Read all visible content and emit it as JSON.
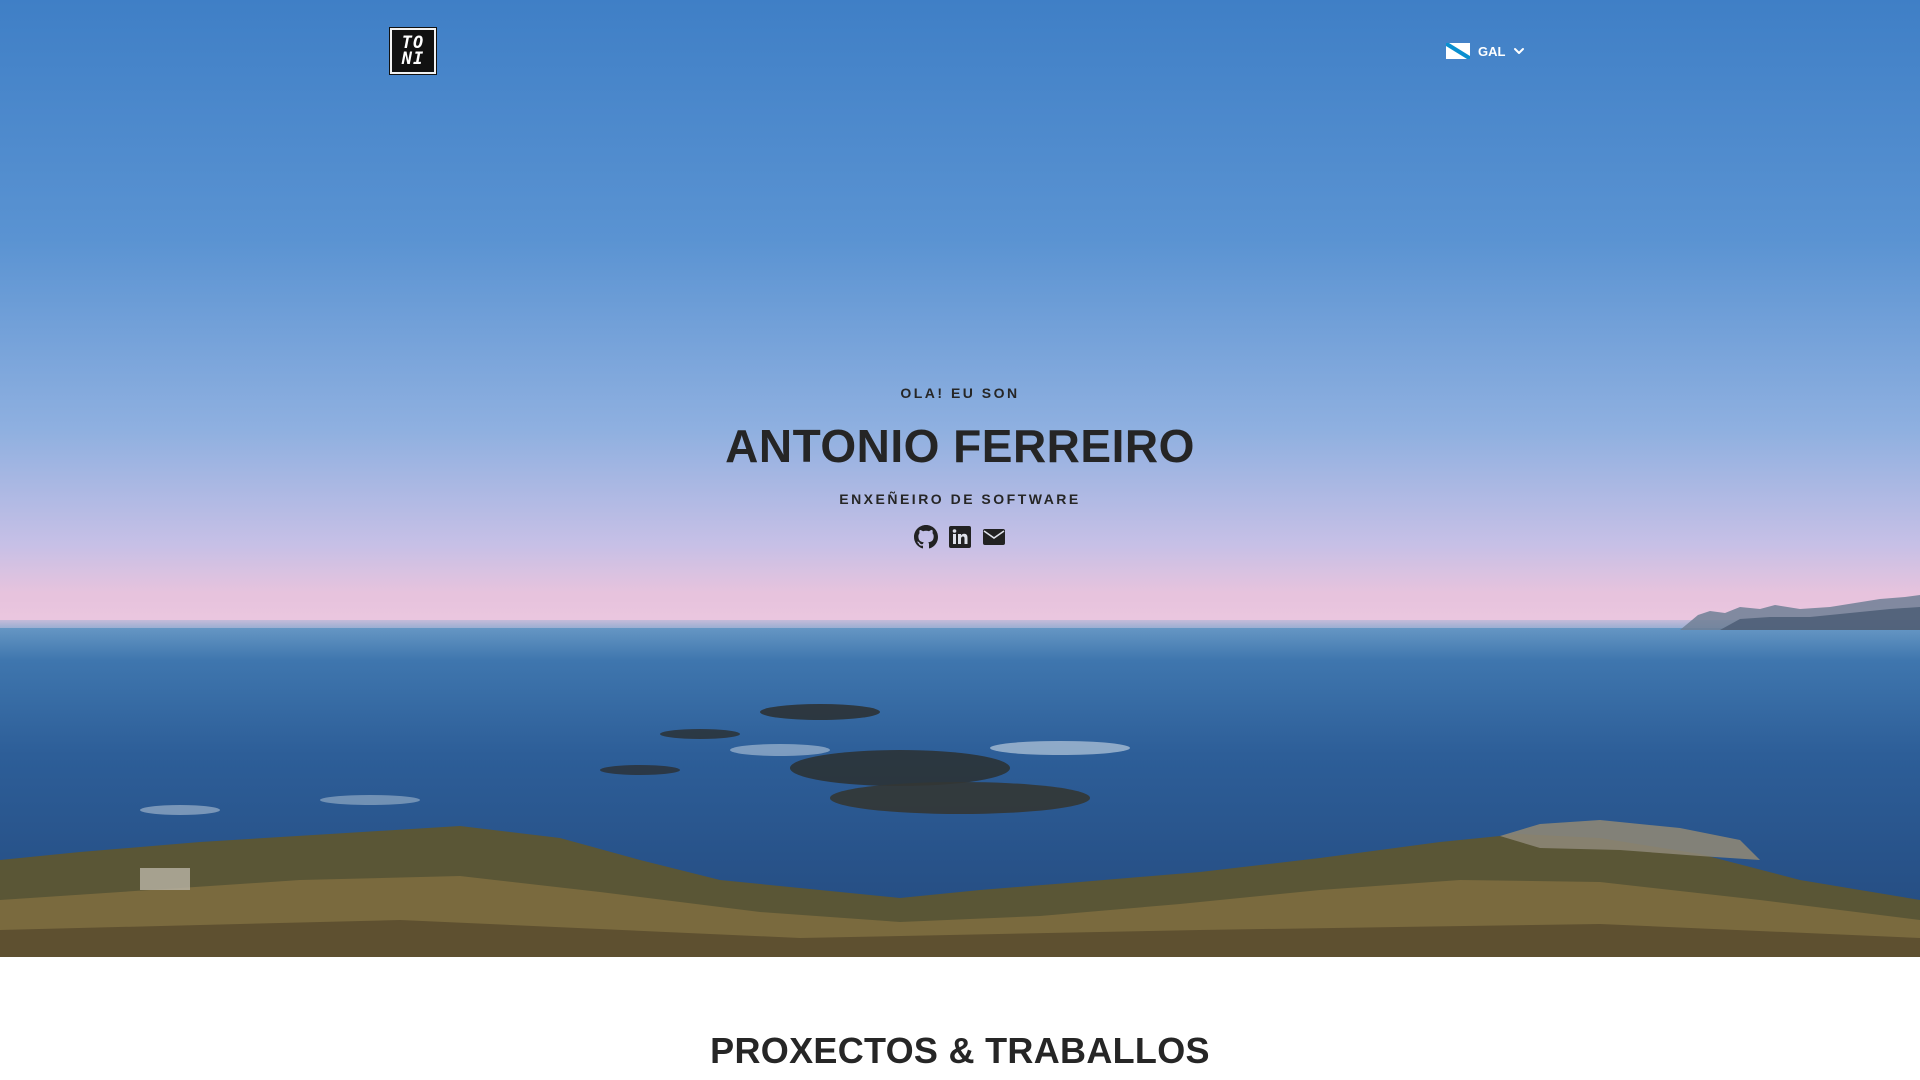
{
  "header": {
    "logo_line1": "TO",
    "logo_line2": "NI",
    "language": {
      "code": "GAL",
      "flag_icon": "galicia-flag-icon"
    }
  },
  "hero": {
    "greeting": "OLA! EU SON",
    "name": "ANTONIO FERREIRO",
    "role": "ENXEÑEIRO DE SOFTWARE",
    "socials": [
      {
        "icon": "github-icon"
      },
      {
        "icon": "linkedin-icon"
      },
      {
        "icon": "envelope-icon"
      }
    ]
  },
  "sections": {
    "projects_title": "PROXECTOS & TRABALLOS"
  },
  "colors": {
    "text": "#262626",
    "accent_flag": "#0a8fd0"
  }
}
